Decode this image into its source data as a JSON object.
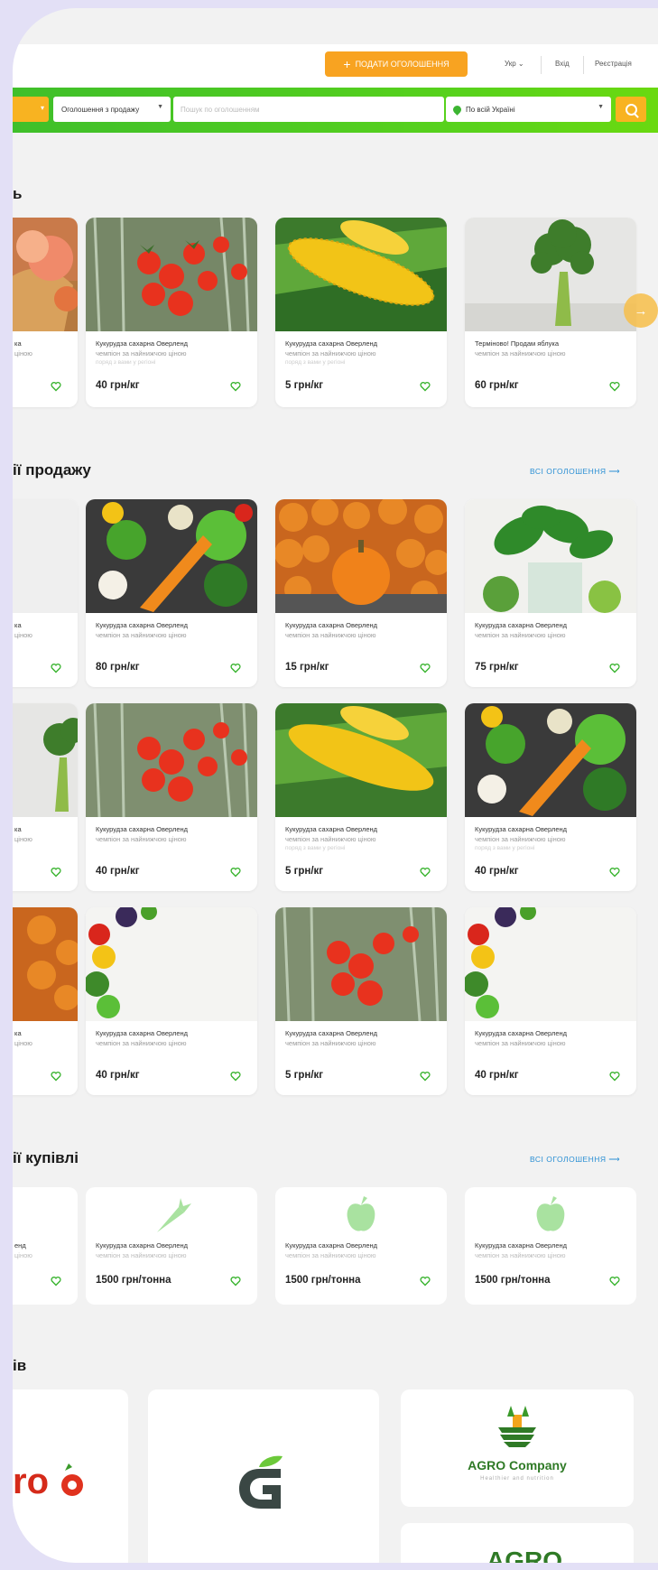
{
  "header": {
    "post_button": "ПОДАТИ ОГОЛОШЕННЯ",
    "lang": "Укр ⌄",
    "login": "Вхід",
    "register": "Реєстрація"
  },
  "search": {
    "type_select": "Оголошення з продажу",
    "placeholder": "Пошук по оголошенням",
    "location": "По всій Україні"
  },
  "sections": {
    "top": {
      "title": "ь"
    },
    "sell": {
      "title": "ії продажу",
      "all_link": "ВСІ ОГОЛОШЕННЯ ⟶"
    },
    "buy": {
      "title": "ії купівлі",
      "all_link": "ВСІ ОГОЛОШЕННЯ ⟶"
    },
    "partners": {
      "title": "ів"
    }
  },
  "common": {
    "line1": "Кукурудза сахарна Оверленд",
    "line2": "чемпіон за найнижчою ціною",
    "line3": "поряд з вами у регіоні",
    "broccoli_title": "Терміново! Продам яблука"
  },
  "top_cards": [
    {
      "name": "peaches",
      "t1": "ка",
      "t2": "ціною",
      "price": ""
    },
    {
      "name": "tomatoes",
      "price": "40 грн/кг"
    },
    {
      "name": "corn",
      "price": "5 грн/кг"
    },
    {
      "name": "broccoli",
      "price": "60 грн/кг"
    }
  ],
  "sell_rows": [
    [
      {
        "price": ""
      },
      {
        "price": "80 грн/кг"
      },
      {
        "price": "15 грн/кг"
      },
      {
        "price": "75 грн/кг"
      }
    ],
    [
      {
        "price": ""
      },
      {
        "price": "40 грн/кг"
      },
      {
        "price": "5 грн/кг"
      },
      {
        "price": "40 грн/кг"
      }
    ],
    [
      {
        "price": ""
      },
      {
        "price": "40 грн/кг"
      },
      {
        "price": "5 грн/кг"
      },
      {
        "price": "40 грн/кг"
      }
    ]
  ],
  "partial_text": {
    "t1": "ка",
    "t2": "ціною"
  },
  "buy_cards": [
    {
      "t1": "енд",
      "t2": "ціною",
      "price": ""
    },
    {
      "icon": "carrot-icon",
      "price": "1500 грн/тонна"
    },
    {
      "icon": "apple-icon",
      "price": "1500 грн/тонна"
    },
    {
      "icon": "apple-icon",
      "price": "1500 грн/тонна"
    }
  ],
  "partners": [
    {
      "text": "ro"
    },
    {
      "text": "G"
    },
    {
      "text": "AGRO Company",
      "subtext": "Healthier and nutrition"
    },
    {
      "text": "AGRO"
    }
  ],
  "colors": {
    "green": "#4ccb20",
    "orange": "#f8a321",
    "link": "#2a8fd4"
  }
}
